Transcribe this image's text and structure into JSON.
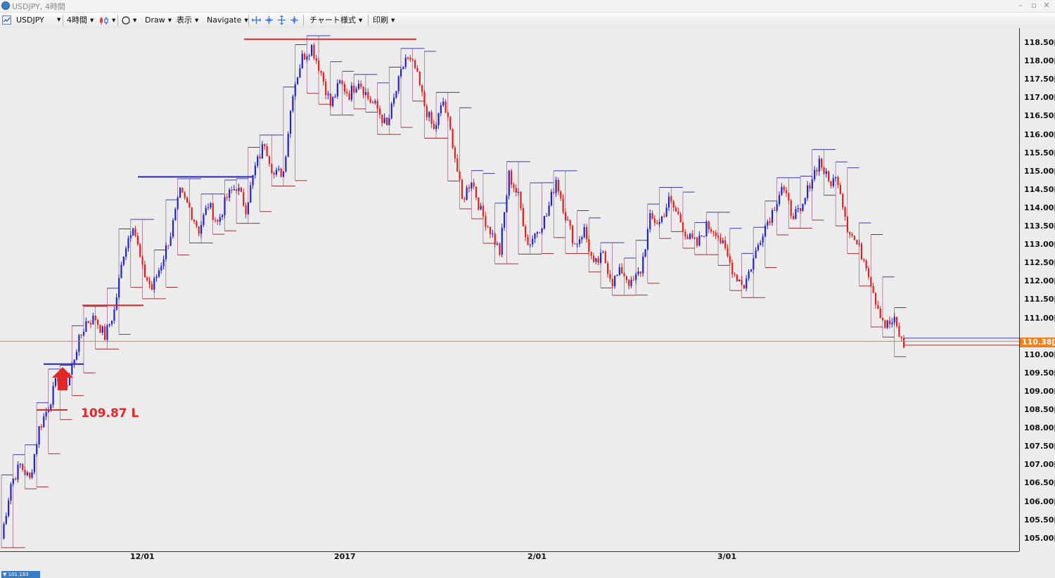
{
  "window": {
    "title": "USDJPY, 4時間"
  },
  "toolbar": {
    "symbol": "USDJPY",
    "timeframe": "4時間",
    "draw": "Draw",
    "view": "表示",
    "navigate": "Navigate",
    "chart_style": "チャート様式",
    "print": "印刷"
  },
  "colors": {
    "bull": "#2323c8",
    "bear": "#e02020",
    "price_line": "#f0801a",
    "axis_text": "#111111"
  },
  "price_axis": {
    "labels": [
      "118.50[0",
      "118.00[0",
      "117.50[0",
      "117.00[0",
      "116.50[0",
      "116.00[0",
      "115.50[0",
      "115.00[0",
      "114.50[0",
      "114.00[0",
      "113.50[0",
      "113.00[0",
      "112.50[0",
      "112.00[0",
      "111.50[0",
      "111.00[0",
      "110.00[0",
      "109.50[0",
      "109.00[0",
      "108.50[0",
      "108.00[0",
      "107.50[0",
      "107.00[0",
      "106.50[0",
      "106.00[0",
      "105.50[0",
      "105.00[0"
    ],
    "current_price": "110.38[0",
    "low_tag": "101.193"
  },
  "time_axis": {
    "labels": [
      "12/01",
      "2017",
      "2/01",
      "3/01"
    ]
  },
  "annotation": {
    "text": "109.87 L"
  },
  "chart_data": {
    "type": "line",
    "title": "",
    "symbol": "USDJPY",
    "timeframe": "4時間",
    "x_labels": [
      "12/01",
      "2017",
      "2/01",
      "3/01"
    ],
    "ylim": [
      104.7,
      118.9
    ],
    "current_price": 110.38,
    "series": [
      {
        "values": [
          105.0,
          106.5,
          107.0,
          106.6,
          108.0,
          108.6,
          109.4,
          109.2,
          110.2,
          110.9,
          111.0,
          110.5,
          111.2,
          112.8,
          113.6,
          112.3,
          111.8,
          112.5,
          113.3,
          114.4,
          114.0,
          113.4,
          114.1,
          113.6,
          114.3,
          114.6,
          114.0,
          115.1,
          115.8,
          114.9,
          115.0,
          117.2,
          118.1,
          118.4,
          117.7,
          116.8,
          117.4,
          117.1,
          117.5,
          117.0,
          116.7,
          116.2,
          117.2,
          118.1,
          117.8,
          116.8,
          116.1,
          116.9,
          115.8,
          114.2,
          114.8,
          113.9,
          113.4,
          112.8,
          114.9,
          114.3,
          113.0,
          113.4,
          113.8,
          114.8,
          113.8,
          113.0,
          113.4,
          112.4,
          112.7,
          112.0,
          112.3,
          111.9,
          112.3,
          113.7,
          113.6,
          114.2,
          113.8,
          113.2,
          113.0,
          113.5,
          113.4,
          112.8,
          112.2,
          111.9,
          112.6,
          113.4,
          113.9,
          114.6,
          113.9,
          113.8,
          114.7,
          115.3,
          114.7,
          114.8,
          113.5,
          113.0,
          112.5,
          111.5,
          110.8,
          110.9,
          110.2
        ]
      }
    ],
    "support_resistance_levels": [
      108.5,
      109.75,
      111.35,
      114.85,
      118.6
    ],
    "annotation": {
      "price": 109.87,
      "text": "109.87 L"
    }
  }
}
